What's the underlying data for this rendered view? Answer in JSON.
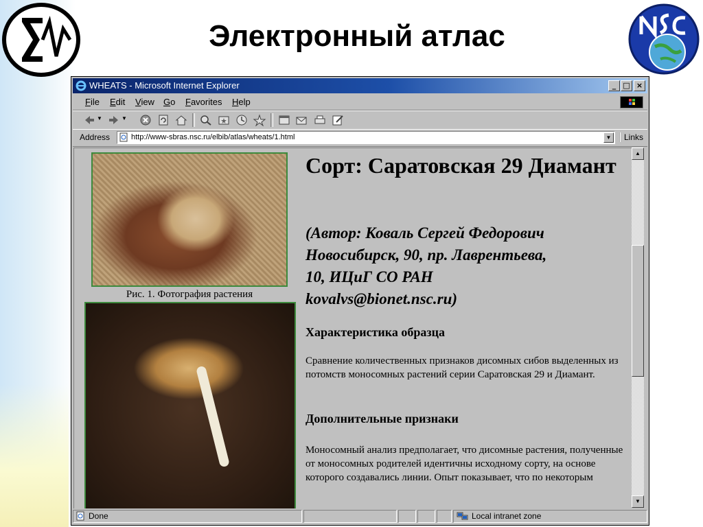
{
  "slide": {
    "title": "Электронный атлас"
  },
  "window": {
    "title": "WHEATS - Microsoft Internet Explorer",
    "controls": {
      "minimize": "_",
      "maximize": "□",
      "close": "×"
    }
  },
  "menu": [
    {
      "label": "File",
      "u": "F",
      "rest": "ile"
    },
    {
      "label": "Edit",
      "u": "E",
      "rest": "dit"
    },
    {
      "label": "View",
      "u": "V",
      "rest": "iew"
    },
    {
      "label": "Go",
      "u": "G",
      "rest": "o"
    },
    {
      "label": "Favorites",
      "u": "F",
      "rest": "avorites"
    },
    {
      "label": "Help",
      "u": "H",
      "rest": "elp"
    }
  ],
  "toolbar_icons": [
    "back-icon",
    "forward-icon",
    "stop-icon",
    "refresh-icon",
    "home-icon",
    "search-icon",
    "favorites-icon",
    "history-icon",
    "channels-icon",
    "fullscreen-icon",
    "mail-icon",
    "print-icon",
    "edit-icon"
  ],
  "address": {
    "label": "Address",
    "url": "http://www-sbras.nsc.ru/elbib/atlas/wheats/1.html",
    "links_label": "Links"
  },
  "content": {
    "caption1": "Рис. 1. Фотография растения",
    "variety_title": "Сорт: Саратовская 29 Диамант",
    "author_line1": "(Автор: Коваль Сергей Федорович",
    "author_line2": "Новосибирск, 90, пр. Лаврентьева,",
    "author_line3": "10, ИЦиГ СО РАН",
    "author_line4": "kovalvs@bionet.nsc.ru)",
    "section1_heading": "Характеристика образца",
    "section1_text": "Сравнение количественных признаков дисомных сибов выделенных из потомств моносомных растений серии Саратовская 29 и Диамант.",
    "section2_heading": "Дополнительные признаки",
    "section2_text": "Моносомный анализ предполагает, что дисомные растения, полученные от моносомных родителей идентичны исходному сорту, на основе которого создавались линии. Опыт показывает, что по некоторым"
  },
  "status": {
    "text": "Done",
    "zone": "Local intranet zone"
  },
  "colors": {
    "titlebar_start": "#0a246a",
    "titlebar_end": "#a6caf0",
    "chrome": "#c0c0c0",
    "photo_border": "#3c8a3c"
  }
}
